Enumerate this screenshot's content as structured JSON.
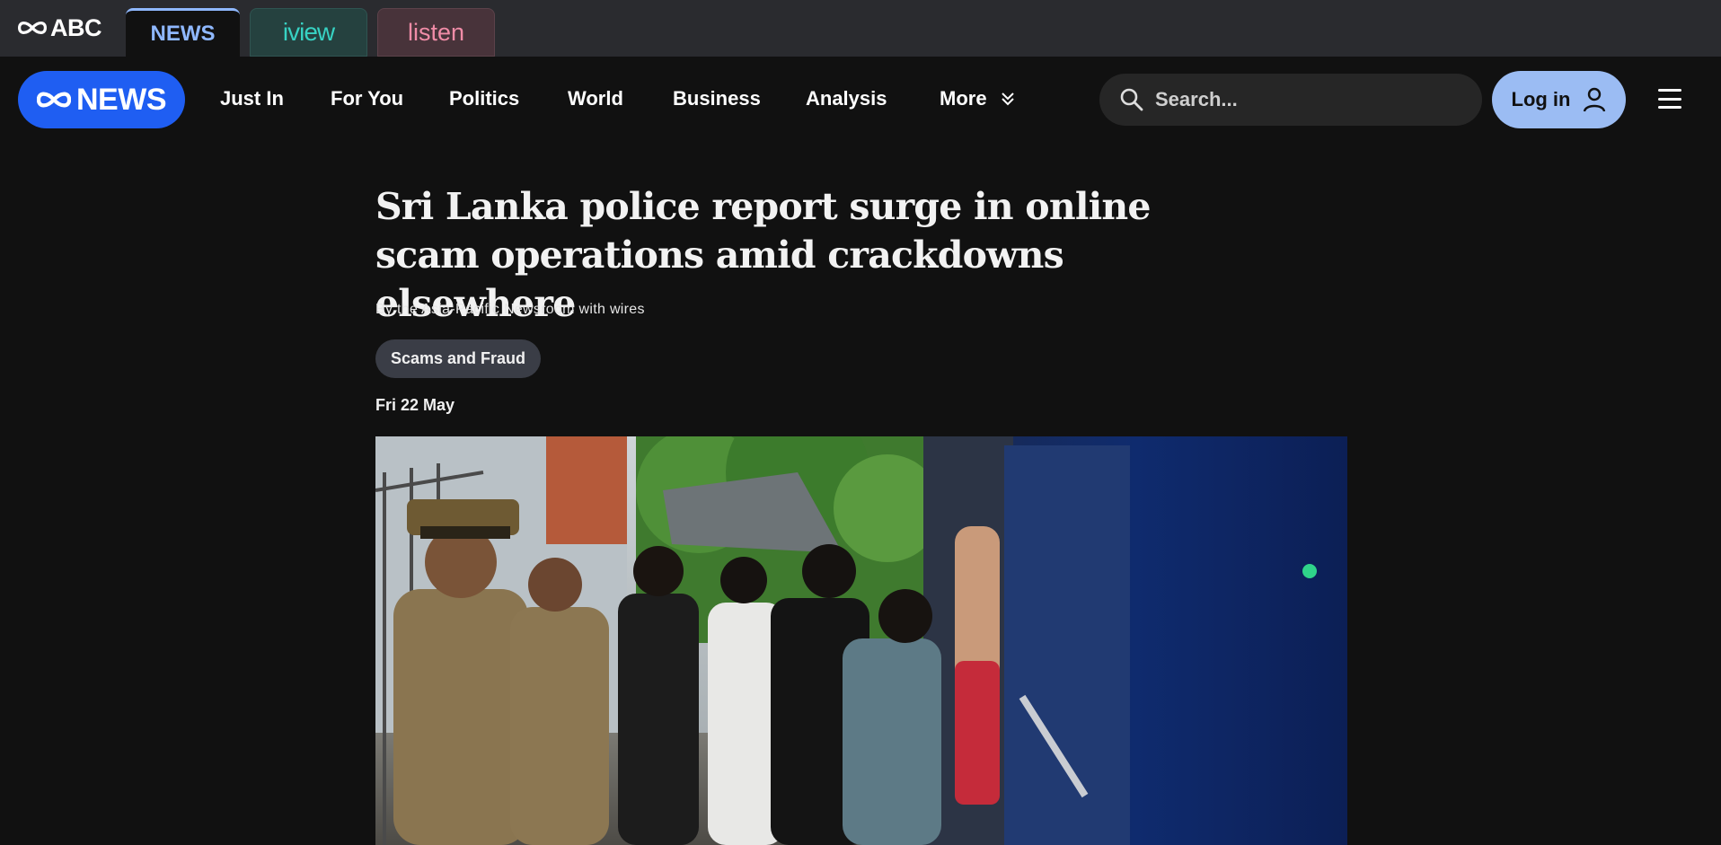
{
  "network": {
    "logo_text": "ABC",
    "tabs": [
      {
        "label": "NEWS",
        "active": true
      },
      {
        "label": "iview",
        "active": false
      },
      {
        "label": "listen",
        "active": false
      }
    ]
  },
  "nav": {
    "logo_text": "NEWS",
    "links": [
      "Just In",
      "For You",
      "Politics",
      "World",
      "Business",
      "Analysis"
    ],
    "more_label": "More",
    "search_placeholder": "Search...",
    "login_label": "Log in"
  },
  "article": {
    "headline": "Sri Lanka police report surge in online scam operations amid crackdowns elsewhere",
    "byline": "By the Asia-Pacific Newsroom with wires",
    "tag": "Scams and Fraud",
    "date": "Fri 22 May"
  },
  "colors": {
    "brand_blue": "#1f5ef2",
    "login_bg": "#9bbcf3",
    "news_tab": "#8fb8ff",
    "iview_tab": "#37d2c3",
    "listen_tab": "#f08ca7"
  },
  "icons": {
    "search": "search-icon",
    "login": "user-icon",
    "more": "double-chevron-down-icon",
    "menu": "hamburger-menu-icon"
  }
}
